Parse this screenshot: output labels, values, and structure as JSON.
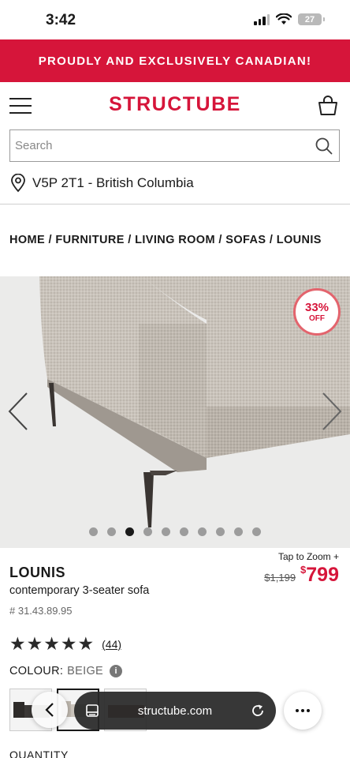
{
  "status_bar": {
    "time": "3:42",
    "battery": "27"
  },
  "promo": {
    "text": "PROUDLY AND EXCLUSIVELY CANADIAN!"
  },
  "header": {
    "logo": "STRUCTUBE"
  },
  "search": {
    "placeholder": "Search"
  },
  "location": {
    "text": "V5P 2T1 - British Columbia"
  },
  "breadcrumb": {
    "items": [
      "HOME",
      "FURNITURE",
      "LIVING ROOM",
      "SOFAS",
      "LOUNIS"
    ],
    "separator": " / "
  },
  "gallery": {
    "badge_percent": "33%",
    "badge_label": "OFF",
    "dot_count": 10,
    "active_dot": 3
  },
  "product": {
    "tap_to_zoom": "Tap to Zoom +",
    "name": "LOUNIS",
    "description": "contemporary 3-seater sofa",
    "sku": "# 31.43.89.95",
    "old_price": "$1,199",
    "price_symbol": "$",
    "price": "799",
    "rating_stars": 5,
    "review_count": "(44)",
    "colour_label": "COLOUR:",
    "colour_value": "BEIGE",
    "quantity_label": "QUANTITY"
  },
  "browser": {
    "url": "structube.com"
  },
  "colors": {
    "brand_red": "#d6153a",
    "badge_ring": "#e3646d"
  },
  "icons": [
    "menu-icon",
    "cart-icon",
    "search-icon",
    "location-pin-icon",
    "chevron-left-icon",
    "chevron-right-icon",
    "info-icon",
    "tabs-icon",
    "reload-icon",
    "more-icon"
  ]
}
